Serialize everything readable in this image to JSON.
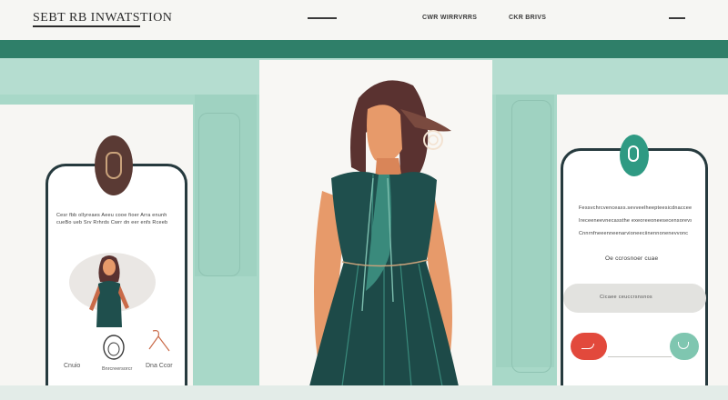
{
  "header": {
    "logo": "SEBT RB INWATSTION",
    "nav_links": [
      "CWR WIRRVRRS",
      "CKR BRIVS"
    ]
  },
  "left_card": {
    "text_lines": [
      "Cesr fbb ollyreaes Aeeu cooe fioer Arra enunh",
      "cueBo ueb Srv Rrhrds Cwrr dn eer enfs Rceeb"
    ],
    "captions": [
      "Cnuio",
      "Bnrcreersorcr",
      "Dna Ccor"
    ]
  },
  "right_card": {
    "text_lines": [
      "Fessvchrcvenceaxs.sevveelheepteesicdnacceeeieae",
      "Ireceeneevnecassthe exeoreeoneesecensorevsnde",
      "Cnnrnfneeenneenarvioneeciinennonenevvonc"
    ],
    "label": "Oe ccrosnoer cuae",
    "search_placeholder": "Cicaee ceuccrsnsnos"
  },
  "colors": {
    "teal_dark": "#2f7f69",
    "teal_light": "#a8d8c8",
    "accent_red": "#e2493c",
    "accent_mint": "#7fc6b0",
    "dress": "#1f4f4d",
    "hair": "#5a3230",
    "skin": "#e79a6a"
  },
  "icons": {
    "left_avatar": "person-glyph-icon",
    "right_avatar": "person-glyph-icon",
    "red_button": "arrow-icon",
    "teal_button": "cup-icon"
  }
}
